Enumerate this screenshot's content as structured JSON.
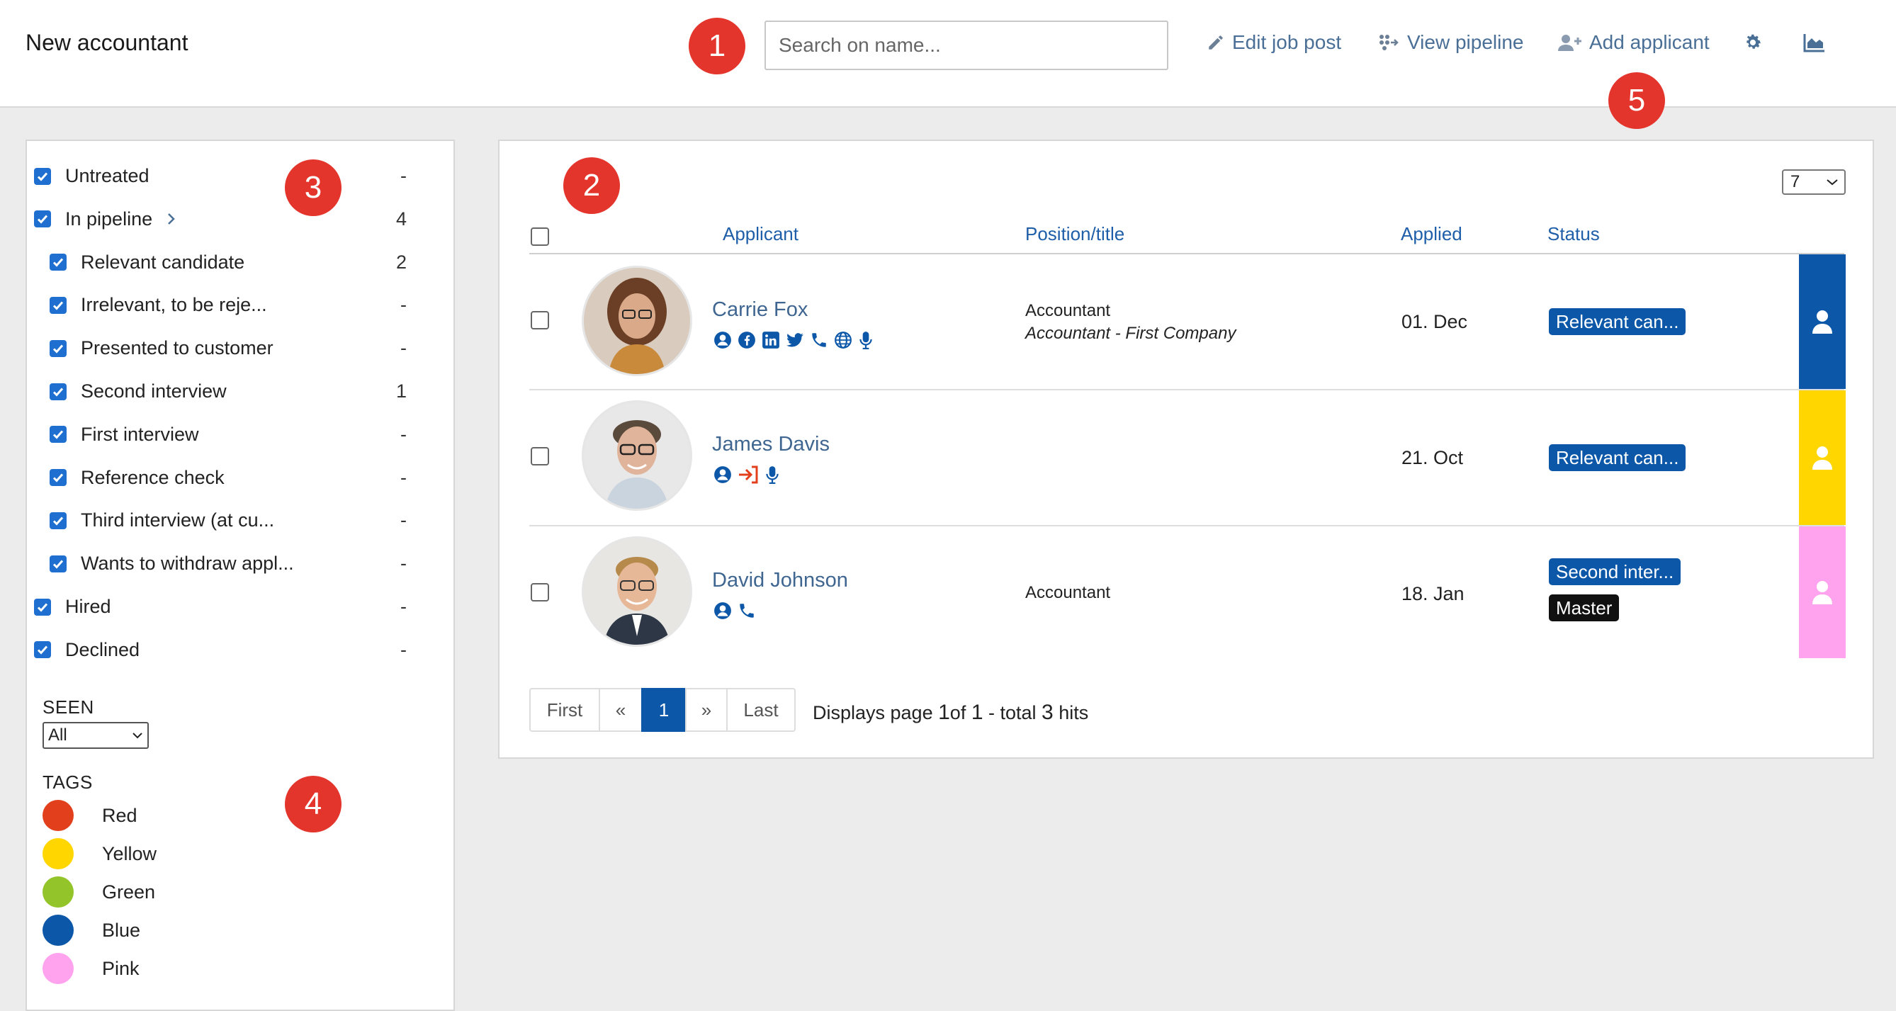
{
  "header": {
    "title": "New accountant",
    "search_placeholder": "Search on name...",
    "edit_job_post": "Edit job post",
    "view_pipeline": "View pipeline",
    "add_applicant": "Add applicant"
  },
  "markers": [
    "1",
    "2",
    "3",
    "4",
    "5"
  ],
  "sidebar": {
    "statuses": [
      {
        "label": "Untreated",
        "count": "-",
        "checked": true
      },
      {
        "label": "In pipeline",
        "count": "4",
        "checked": true
      },
      {
        "label": "Relevant candidate",
        "count": "2",
        "checked": true
      },
      {
        "label": "Irrelevant, to be reje...",
        "count": "-",
        "checked": true
      },
      {
        "label": "Presented to customer",
        "count": "-",
        "checked": true
      },
      {
        "label": "Second interview",
        "count": "1",
        "checked": true
      },
      {
        "label": "First interview",
        "count": "-",
        "checked": true
      },
      {
        "label": "Reference check",
        "count": "-",
        "checked": true
      },
      {
        "label": "Third interview (at cu...",
        "count": "-",
        "checked": true
      },
      {
        "label": "Wants to withdraw appl...",
        "count": "-",
        "checked": true
      },
      {
        "label": "Hired",
        "count": "-",
        "checked": true
      },
      {
        "label": "Declined",
        "count": "-",
        "checked": true
      }
    ],
    "seen_label": "SEEN",
    "seen_value": "All",
    "tags_label": "TAGS",
    "tags": [
      {
        "label": "Red",
        "color": "#e2401c"
      },
      {
        "label": "Yellow",
        "color": "#ffd600"
      },
      {
        "label": "Green",
        "color": "#93c42a"
      },
      {
        "label": "Blue",
        "color": "#0c57a8"
      },
      {
        "label": "Pink",
        "color": "#ffa3ee"
      }
    ]
  },
  "table": {
    "per_page": "7",
    "columns": {
      "applicant": "Applicant",
      "position": "Position/title",
      "applied": "Applied",
      "status": "Status"
    },
    "rows": [
      {
        "name": "Carrie Fox",
        "icons": [
          "user-circle-icon",
          "facebook-icon",
          "linkedin-icon",
          "twitter-icon",
          "phone-icon",
          "globe-icon",
          "microphone-icon"
        ],
        "position": "Accountant",
        "position_sub": "Accountant - First Company",
        "applied": "01. Dec",
        "badges": [
          {
            "text": "Relevant can...",
            "style": "blue"
          }
        ],
        "tag_color": "#0c57a8"
      },
      {
        "name": "James Davis",
        "icons": [
          "user-circle-icon",
          "sign-in-icon",
          "microphone-icon"
        ],
        "position": "",
        "position_sub": "",
        "applied": "21. Oct",
        "badges": [
          {
            "text": "Relevant can...",
            "style": "blue"
          }
        ],
        "tag_color": "#ffd600"
      },
      {
        "name": "David Johnson",
        "icons": [
          "user-circle-icon",
          "phone-icon"
        ],
        "position": "Accountant",
        "position_sub": "",
        "applied": "18. Jan",
        "badges": [
          {
            "text": "Second inter...",
            "style": "blue"
          },
          {
            "text": "Master",
            "style": "black"
          }
        ],
        "tag_color": "#ffa3ee"
      }
    ]
  },
  "pagination": {
    "first": "First",
    "prev": "«",
    "current": "1",
    "next": "»",
    "last": "Last",
    "info_prefix": "Displays page ",
    "info_page": "1",
    "info_of": "of ",
    "info_total_pages": "1",
    "info_total_label": " - total ",
    "info_hits": "3",
    "info_suffix": " hits"
  }
}
